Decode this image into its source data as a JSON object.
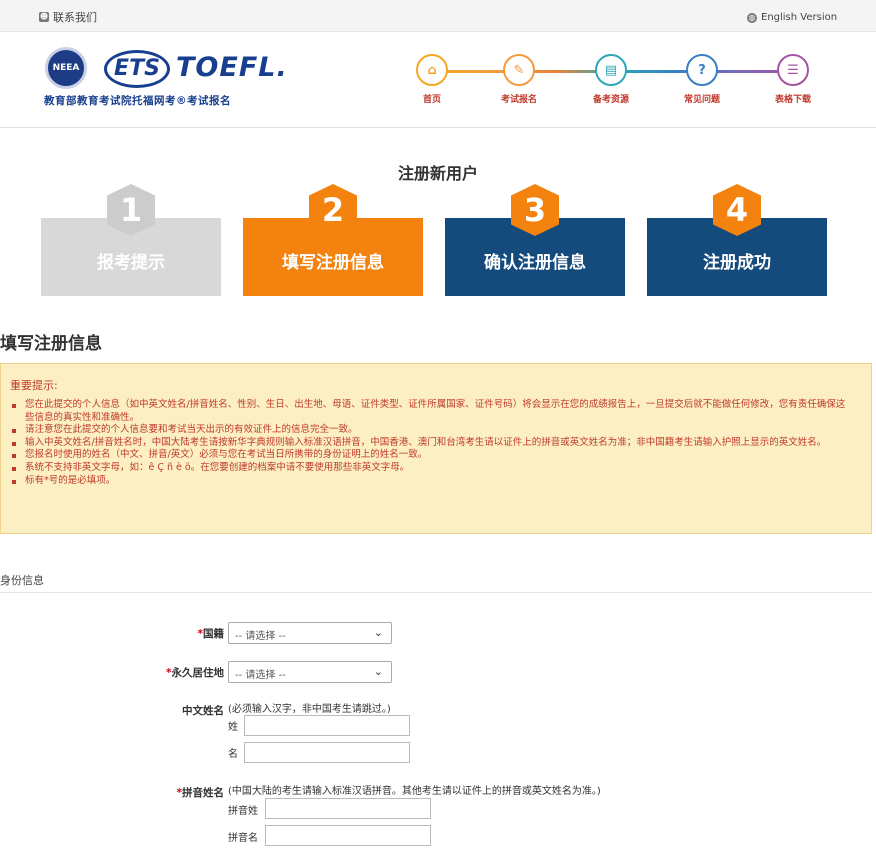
{
  "topbar": {
    "contact": "联系我们",
    "english": "English Version"
  },
  "brand": {
    "seal_text": "NEEA",
    "ets": "ETS",
    "toefl": "TOEFL.",
    "subtitle": "教育部教育考试院托福网考®考试报名"
  },
  "nav": {
    "items": [
      {
        "label": "首页",
        "icon": "home-icon",
        "color": "#f5a623"
      },
      {
        "label": "考试报名",
        "icon": "pen-icon",
        "color": "#f39b3c"
      },
      {
        "label": "备考资源",
        "icon": "book-icon",
        "color": "#2aa7b8"
      },
      {
        "label": "常见问题",
        "icon": "question-icon",
        "color": "#3a7ec5"
      },
      {
        "label": "表格下载",
        "icon": "document-icon",
        "color": "#a455a2"
      }
    ]
  },
  "page_title": "注册新用户",
  "steps": [
    {
      "num": "1",
      "label": "报考提示",
      "color": "#d8d8d8",
      "num_color": "#cccccc"
    },
    {
      "num": "2",
      "label": "填写注册信息",
      "color": "#f4820f",
      "num_color": "#f4820f"
    },
    {
      "num": "3",
      "label": "确认注册信息",
      "color": "#144a7c",
      "num_color": "#f4820f"
    },
    {
      "num": "4",
      "label": "注册成功",
      "color": "#144a7c",
      "num_color": "#f4820f"
    }
  ],
  "section_title": "填写注册信息",
  "notice": {
    "title": "重要提示:",
    "items": [
      "您在此提交的个人信息（如中英文姓名/拼音姓名、性别、生日、出生地、母语、证件类型、证件所属国家、证件号码）将会显示在您的成绩报告上，一旦提交后就不能做任何修改，您有责任确保这些信息的真实性和准确性。",
      "请注意您在此提交的个人信息要和考试当天出示的有效证件上的信息完全一致。",
      "输入中英文姓名/拼音姓名时，中国大陆考生请按新华字典规则输入标准汉语拼音，中国香港、澳门和台湾考生请以证件上的拼音或英文姓名为准；非中国籍考生请输入护照上显示的英文姓名。",
      "您报名时使用的姓名（中文、拼音/英文）必须与您在考试当日所携带的身份证明上的姓名一致。",
      "系统不支持非英文字母，如：ê Ç ñ è ö。在您要创建的档案中请不要使用那些非英文字母。",
      "标有*号的是必填项。"
    ]
  },
  "identity": {
    "heading": "身份信息",
    "nationality_label": "国籍",
    "residence_label": "永久居住地",
    "select_placeholder": "-- 请选择 --",
    "cn_name_label": "中文姓名",
    "cn_name_hint": "(必须输入汉字，非中国考生请跳过。)",
    "surname_label": "姓",
    "given_label": "名",
    "pinyin_label": "拼音姓名",
    "pinyin_hint": "(中国大陆的考生请输入标准汉语拼音。其他考生请以证件上的拼音或英文姓名为准。)",
    "pinyin_surname_label": "拼音姓",
    "pinyin_given_label": "拼音名",
    "required_mark": "*"
  }
}
